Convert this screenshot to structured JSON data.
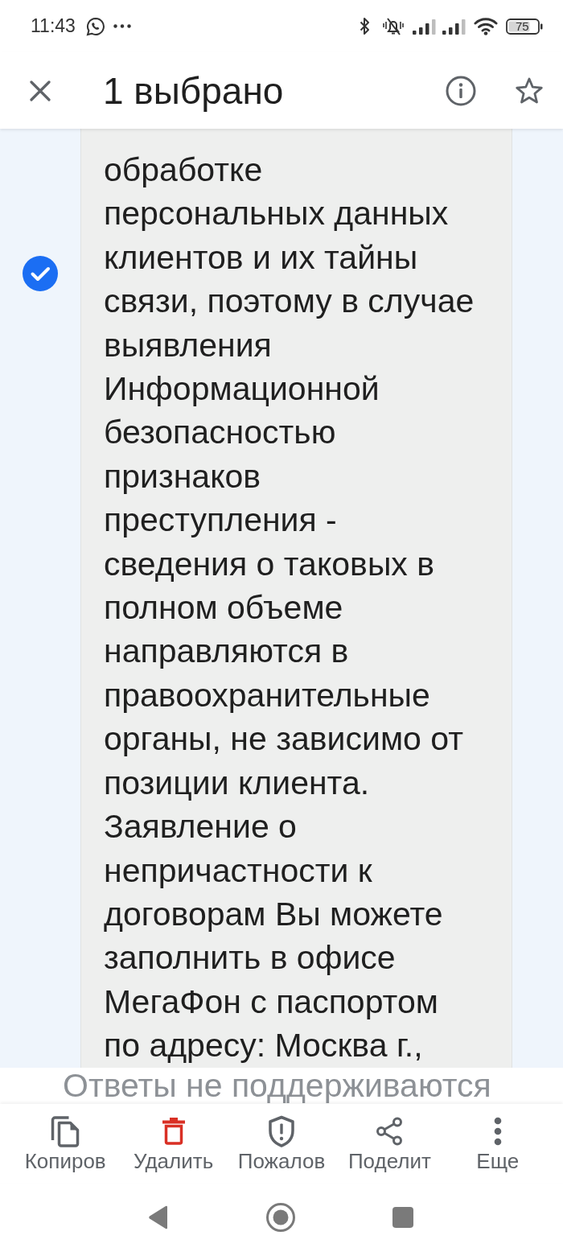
{
  "status_bar": {
    "time": "11:43",
    "battery": "75"
  },
  "app_bar": {
    "title": "1 выбрано"
  },
  "message": {
    "selected": true,
    "text": "обработке\nперсональных данных\nклиентов и их тайны\nсвязи, поэтому в случае\nвыявления\nИнформационной\nбезопасностью\nпризнаков\nпреступления -\nсведения о таковых в\nполном объеме\nнаправляются в\nправоохранительные\nорганы, не зависимо от\nпозиции клиента.\nЗаявление о\nнепричастности к\nдоговорам Вы можете\nзаполнить в офисе\nМегаФон с паспортом\nпо адресу: Москва г.,"
  },
  "reply_notice": "Ответы не поддерживаются",
  "actions": [
    {
      "kind": "copy",
      "label": "Копиров"
    },
    {
      "kind": "delete",
      "label": "Удалить"
    },
    {
      "kind": "report",
      "label": "Пожалов"
    },
    {
      "kind": "share",
      "label": "Поделит"
    },
    {
      "kind": "more",
      "label": "Еще"
    }
  ]
}
